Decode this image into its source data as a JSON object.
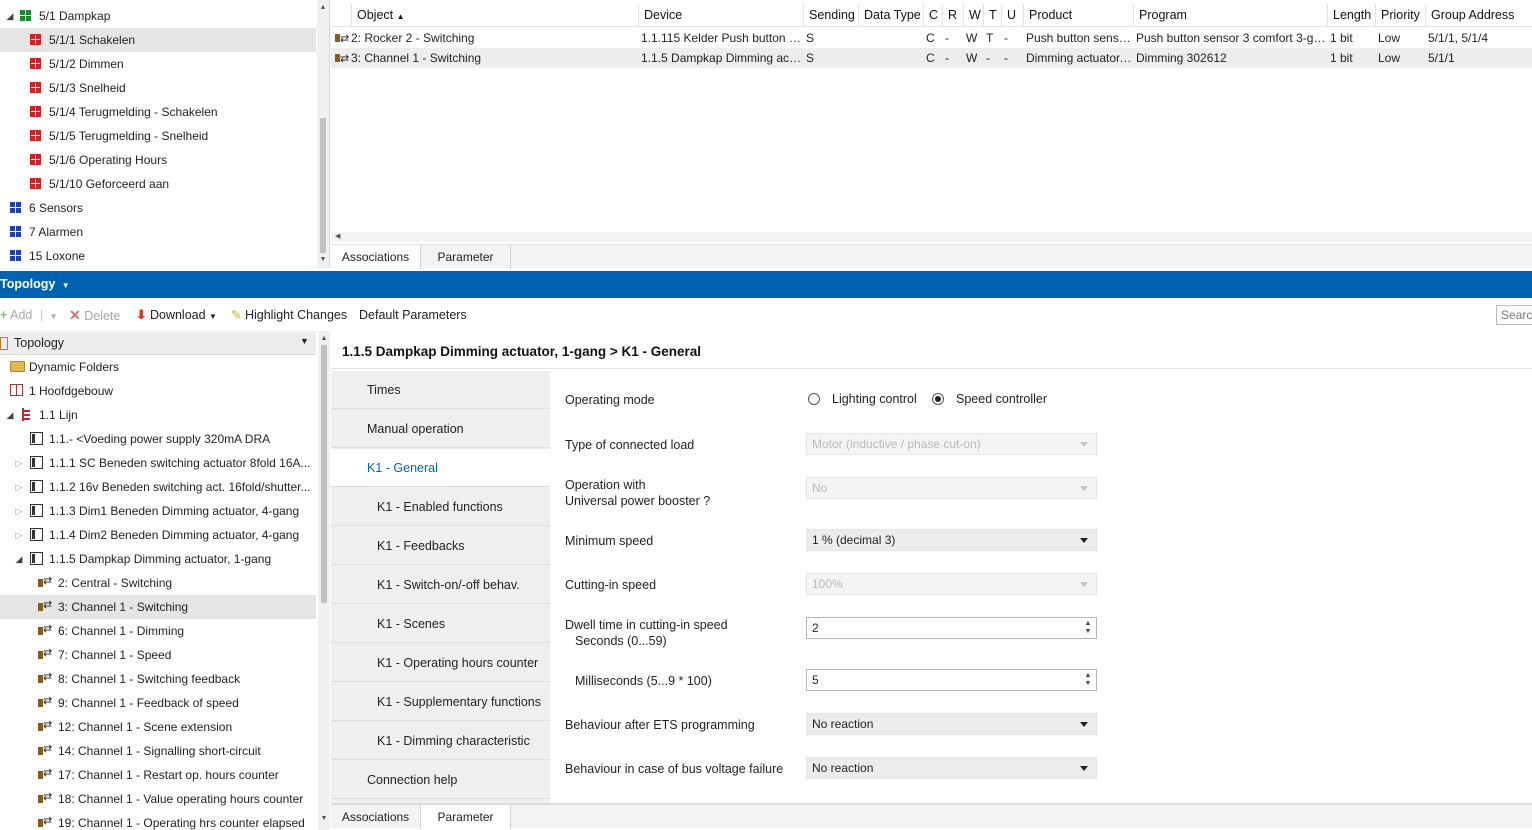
{
  "group_tree": {
    "items": [
      {
        "caret": "◢",
        "label": "5/1 Dampkap",
        "icon": "group-green-icon"
      },
      {
        "caret": "",
        "label": "5/1/1 Schakelen",
        "icon": "group-red-icon",
        "selected": true
      },
      {
        "caret": "",
        "label": "5/1/2 Dimmen",
        "icon": "group-red-icon"
      },
      {
        "caret": "",
        "label": "5/1/3 Snelheid",
        "icon": "group-red-icon"
      },
      {
        "caret": "",
        "label": "5/1/4 Terugmelding - Schakelen",
        "icon": "group-red-icon"
      },
      {
        "caret": "",
        "label": "5/1/5 Terugmelding - Snelheid",
        "icon": "group-red-icon"
      },
      {
        "caret": "",
        "label": "5/1/6 Operating Hours",
        "icon": "group-red-icon"
      },
      {
        "caret": "",
        "label": "5/1/10 Geforceerd aan",
        "icon": "group-red-icon"
      },
      {
        "caret": "",
        "label": "6 Sensors",
        "icon": "group-blue-icon"
      },
      {
        "caret": "",
        "label": "7 Alarmen",
        "icon": "group-blue-icon"
      },
      {
        "caret": "",
        "label": "15 Loxone",
        "icon": "group-blue-icon"
      }
    ]
  },
  "object_grid": {
    "columns": [
      "Object",
      "Device",
      "Sending",
      "Data Type",
      "C",
      "R",
      "W",
      "T",
      "U",
      "Product",
      "Program",
      "Length",
      "Priority",
      "Group Address"
    ],
    "sort_indicator": "▲",
    "rows": [
      {
        "object": "2: Rocker 2 - Switching",
        "device": "1.1.115 Kelder Push button sen...",
        "sending": "S",
        "data_type": "",
        "c": "C",
        "r": "-",
        "w": "W",
        "t": "T",
        "u": "-",
        "product": "Push button sensor...",
        "program": "Push button sensor 3 comfort 3-ga...",
        "length": "1 bit",
        "priority": "Low",
        "group_address": "5/1/1, 5/1/4"
      },
      {
        "object": "3: Channel 1 - Switching",
        "device": "1.1.5 Dampkap Dimming actua...",
        "sending": "S",
        "data_type": "",
        "c": "C",
        "r": "-",
        "w": "W",
        "t": "-",
        "u": "-",
        "product": "Dimming actuator,...",
        "program": "Dimming 302612",
        "length": "1 bit",
        "priority": "Low",
        "group_address": "5/1/1",
        "selected": true
      }
    ],
    "tabs": [
      "Associations",
      "Parameter"
    ]
  },
  "panel_bar": {
    "title": "Topology",
    "dropdown_glyph": "▼"
  },
  "toolbar": {
    "add_label": "Add",
    "delete_label": "Delete",
    "download_label": "Download",
    "highlight_label": "Highlight Changes",
    "default_params_label": "Default Parameters",
    "search_placeholder": "Search"
  },
  "topology": {
    "header": "Topology",
    "items": [
      {
        "caret": "",
        "label": "Dynamic Folders",
        "icon": "folder-icon",
        "indent": 0
      },
      {
        "caret": "",
        "label": "1 Hoofdgebouw",
        "icon": "building-icon",
        "indent": 0
      },
      {
        "caret": "◢",
        "label": "1.1 Lijn",
        "icon": "line-icon",
        "indent": 0
      },
      {
        "caret": "",
        "label": "1.1.- <Voeding power supply 320mA DRA",
        "icon": "device-icon",
        "indent": 1
      },
      {
        "caret": "▷",
        "label": "1.1.1 SC Beneden switching actuator 8fold 16A...",
        "icon": "device-icon",
        "indent": 1
      },
      {
        "caret": "▷",
        "label": "1.1.2 16v Beneden switching act. 16fold/shutter...",
        "icon": "device-icon",
        "indent": 1
      },
      {
        "caret": "▷",
        "label": "1.1.3 Dim1 Beneden Dimming actuator, 4-gang",
        "icon": "device-icon",
        "indent": 1
      },
      {
        "caret": "▷",
        "label": "1.1.4 Dim2 Beneden Dimming actuator, 4-gang",
        "icon": "device-icon",
        "indent": 1
      },
      {
        "caret": "◢",
        "label": "1.1.5 Dampkap Dimming actuator, 1-gang",
        "icon": "device-icon",
        "indent": 1
      },
      {
        "caret": "",
        "label": "2: Central - Switching",
        "icon": "object-icon",
        "indent": 2
      },
      {
        "caret": "",
        "label": "3: Channel 1 - Switching",
        "icon": "object-icon",
        "indent": 2,
        "selected": true
      },
      {
        "caret": "",
        "label": "6: Channel 1 - Dimming",
        "icon": "object-icon",
        "indent": 2
      },
      {
        "caret": "",
        "label": "7: Channel 1 - Speed",
        "icon": "object-icon",
        "indent": 2
      },
      {
        "caret": "",
        "label": "8: Channel 1 - Switching feedback",
        "icon": "object-icon",
        "indent": 2
      },
      {
        "caret": "",
        "label": "9: Channel 1 - Feedback of speed",
        "icon": "object-icon",
        "indent": 2
      },
      {
        "caret": "",
        "label": "12: Channel 1 - Scene extension",
        "icon": "object-icon",
        "indent": 2
      },
      {
        "caret": "",
        "label": "14: Channel 1 - Signalling short-circuit",
        "icon": "object-icon",
        "indent": 2
      },
      {
        "caret": "",
        "label": "17: Channel 1 - Restart op. hours counter",
        "icon": "object-icon",
        "indent": 2
      },
      {
        "caret": "",
        "label": "18: Channel 1 - Value operating hours counter",
        "icon": "object-icon",
        "indent": 2
      },
      {
        "caret": "",
        "label": "19: Channel 1 - Operating hrs counter elapsed",
        "icon": "object-icon",
        "indent": 2
      }
    ]
  },
  "parameters": {
    "title": "1.1.5 Dampkap Dimming actuator, 1-gang > K1 - General",
    "nav": [
      {
        "label": "Times",
        "sub": false
      },
      {
        "label": "Manual operation",
        "sub": false
      },
      {
        "label": "K1 - General",
        "sub": false,
        "active": true
      },
      {
        "label": "K1 - Enabled functions",
        "sub": true
      },
      {
        "label": "K1 - Feedbacks",
        "sub": true
      },
      {
        "label": "K1 - Switch-on/-off behav.",
        "sub": true
      },
      {
        "label": "K1 - Scenes",
        "sub": true
      },
      {
        "label": "K1 - Operating hours counter",
        "sub": true
      },
      {
        "label": "K1 - Supplementary functions",
        "sub": true
      },
      {
        "label": "K1 - Dimming characteristic",
        "sub": true
      },
      {
        "label": "Connection help",
        "sub": false
      }
    ],
    "operating_mode": {
      "label": "Operating mode",
      "options": [
        "Lighting control",
        "Speed controller"
      ],
      "selected": "Speed controller"
    },
    "connected_load": {
      "label": "Type of connected load",
      "value": "Motor (inductive / phase cut-on)"
    },
    "power_booster": {
      "label_line1": "Operation with",
      "label_line2": "Universal power booster ?",
      "value": "No"
    },
    "minimum_speed": {
      "label": "Minimum speed",
      "value": "1 % (decimal 3)"
    },
    "cutting_in_speed": {
      "label": "Cutting-in speed",
      "value": "100%"
    },
    "dwell_seconds": {
      "label_line1": "Dwell time in cutting-in speed",
      "label_line2": "Seconds (0...59)",
      "value": "2"
    },
    "dwell_ms": {
      "label": "Milliseconds (5...9 * 100)",
      "value": "5"
    },
    "after_programming": {
      "label": "Behaviour after ETS programming",
      "value": "No reaction"
    },
    "bus_failure": {
      "label": "Behaviour in case of bus voltage failure",
      "value": "No reaction"
    },
    "tabs": [
      "Associations",
      "Parameter"
    ]
  }
}
